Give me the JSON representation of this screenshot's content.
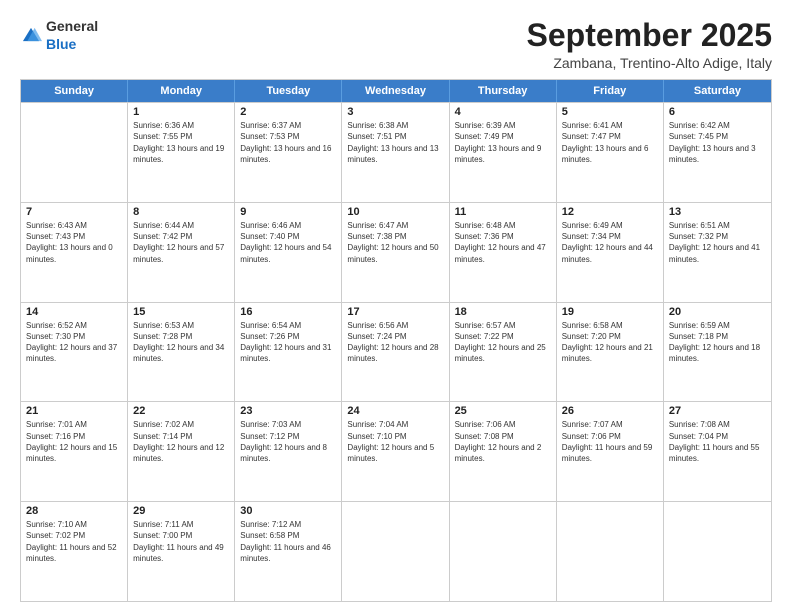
{
  "logo": {
    "general": "General",
    "blue": "Blue"
  },
  "header": {
    "month": "September 2025",
    "location": "Zambana, Trentino-Alto Adige, Italy"
  },
  "weekdays": [
    "Sunday",
    "Monday",
    "Tuesday",
    "Wednesday",
    "Thursday",
    "Friday",
    "Saturday"
  ],
  "weeks": [
    [
      {
        "day": "",
        "sunrise": "",
        "sunset": "",
        "daylight": ""
      },
      {
        "day": "1",
        "sunrise": "Sunrise: 6:36 AM",
        "sunset": "Sunset: 7:55 PM",
        "daylight": "Daylight: 13 hours and 19 minutes."
      },
      {
        "day": "2",
        "sunrise": "Sunrise: 6:37 AM",
        "sunset": "Sunset: 7:53 PM",
        "daylight": "Daylight: 13 hours and 16 minutes."
      },
      {
        "day": "3",
        "sunrise": "Sunrise: 6:38 AM",
        "sunset": "Sunset: 7:51 PM",
        "daylight": "Daylight: 13 hours and 13 minutes."
      },
      {
        "day": "4",
        "sunrise": "Sunrise: 6:39 AM",
        "sunset": "Sunset: 7:49 PM",
        "daylight": "Daylight: 13 hours and 9 minutes."
      },
      {
        "day": "5",
        "sunrise": "Sunrise: 6:41 AM",
        "sunset": "Sunset: 7:47 PM",
        "daylight": "Daylight: 13 hours and 6 minutes."
      },
      {
        "day": "6",
        "sunrise": "Sunrise: 6:42 AM",
        "sunset": "Sunset: 7:45 PM",
        "daylight": "Daylight: 13 hours and 3 minutes."
      }
    ],
    [
      {
        "day": "7",
        "sunrise": "Sunrise: 6:43 AM",
        "sunset": "Sunset: 7:43 PM",
        "daylight": "Daylight: 13 hours and 0 minutes."
      },
      {
        "day": "8",
        "sunrise": "Sunrise: 6:44 AM",
        "sunset": "Sunset: 7:42 PM",
        "daylight": "Daylight: 12 hours and 57 minutes."
      },
      {
        "day": "9",
        "sunrise": "Sunrise: 6:46 AM",
        "sunset": "Sunset: 7:40 PM",
        "daylight": "Daylight: 12 hours and 54 minutes."
      },
      {
        "day": "10",
        "sunrise": "Sunrise: 6:47 AM",
        "sunset": "Sunset: 7:38 PM",
        "daylight": "Daylight: 12 hours and 50 minutes."
      },
      {
        "day": "11",
        "sunrise": "Sunrise: 6:48 AM",
        "sunset": "Sunset: 7:36 PM",
        "daylight": "Daylight: 12 hours and 47 minutes."
      },
      {
        "day": "12",
        "sunrise": "Sunrise: 6:49 AM",
        "sunset": "Sunset: 7:34 PM",
        "daylight": "Daylight: 12 hours and 44 minutes."
      },
      {
        "day": "13",
        "sunrise": "Sunrise: 6:51 AM",
        "sunset": "Sunset: 7:32 PM",
        "daylight": "Daylight: 12 hours and 41 minutes."
      }
    ],
    [
      {
        "day": "14",
        "sunrise": "Sunrise: 6:52 AM",
        "sunset": "Sunset: 7:30 PM",
        "daylight": "Daylight: 12 hours and 37 minutes."
      },
      {
        "day": "15",
        "sunrise": "Sunrise: 6:53 AM",
        "sunset": "Sunset: 7:28 PM",
        "daylight": "Daylight: 12 hours and 34 minutes."
      },
      {
        "day": "16",
        "sunrise": "Sunrise: 6:54 AM",
        "sunset": "Sunset: 7:26 PM",
        "daylight": "Daylight: 12 hours and 31 minutes."
      },
      {
        "day": "17",
        "sunrise": "Sunrise: 6:56 AM",
        "sunset": "Sunset: 7:24 PM",
        "daylight": "Daylight: 12 hours and 28 minutes."
      },
      {
        "day": "18",
        "sunrise": "Sunrise: 6:57 AM",
        "sunset": "Sunset: 7:22 PM",
        "daylight": "Daylight: 12 hours and 25 minutes."
      },
      {
        "day": "19",
        "sunrise": "Sunrise: 6:58 AM",
        "sunset": "Sunset: 7:20 PM",
        "daylight": "Daylight: 12 hours and 21 minutes."
      },
      {
        "day": "20",
        "sunrise": "Sunrise: 6:59 AM",
        "sunset": "Sunset: 7:18 PM",
        "daylight": "Daylight: 12 hours and 18 minutes."
      }
    ],
    [
      {
        "day": "21",
        "sunrise": "Sunrise: 7:01 AM",
        "sunset": "Sunset: 7:16 PM",
        "daylight": "Daylight: 12 hours and 15 minutes."
      },
      {
        "day": "22",
        "sunrise": "Sunrise: 7:02 AM",
        "sunset": "Sunset: 7:14 PM",
        "daylight": "Daylight: 12 hours and 12 minutes."
      },
      {
        "day": "23",
        "sunrise": "Sunrise: 7:03 AM",
        "sunset": "Sunset: 7:12 PM",
        "daylight": "Daylight: 12 hours and 8 minutes."
      },
      {
        "day": "24",
        "sunrise": "Sunrise: 7:04 AM",
        "sunset": "Sunset: 7:10 PM",
        "daylight": "Daylight: 12 hours and 5 minutes."
      },
      {
        "day": "25",
        "sunrise": "Sunrise: 7:06 AM",
        "sunset": "Sunset: 7:08 PM",
        "daylight": "Daylight: 12 hours and 2 minutes."
      },
      {
        "day": "26",
        "sunrise": "Sunrise: 7:07 AM",
        "sunset": "Sunset: 7:06 PM",
        "daylight": "Daylight: 11 hours and 59 minutes."
      },
      {
        "day": "27",
        "sunrise": "Sunrise: 7:08 AM",
        "sunset": "Sunset: 7:04 PM",
        "daylight": "Daylight: 11 hours and 55 minutes."
      }
    ],
    [
      {
        "day": "28",
        "sunrise": "Sunrise: 7:10 AM",
        "sunset": "Sunset: 7:02 PM",
        "daylight": "Daylight: 11 hours and 52 minutes."
      },
      {
        "day": "29",
        "sunrise": "Sunrise: 7:11 AM",
        "sunset": "Sunset: 7:00 PM",
        "daylight": "Daylight: 11 hours and 49 minutes."
      },
      {
        "day": "30",
        "sunrise": "Sunrise: 7:12 AM",
        "sunset": "Sunset: 6:58 PM",
        "daylight": "Daylight: 11 hours and 46 minutes."
      },
      {
        "day": "",
        "sunrise": "",
        "sunset": "",
        "daylight": ""
      },
      {
        "day": "",
        "sunrise": "",
        "sunset": "",
        "daylight": ""
      },
      {
        "day": "",
        "sunrise": "",
        "sunset": "",
        "daylight": ""
      },
      {
        "day": "",
        "sunrise": "",
        "sunset": "",
        "daylight": ""
      }
    ]
  ]
}
